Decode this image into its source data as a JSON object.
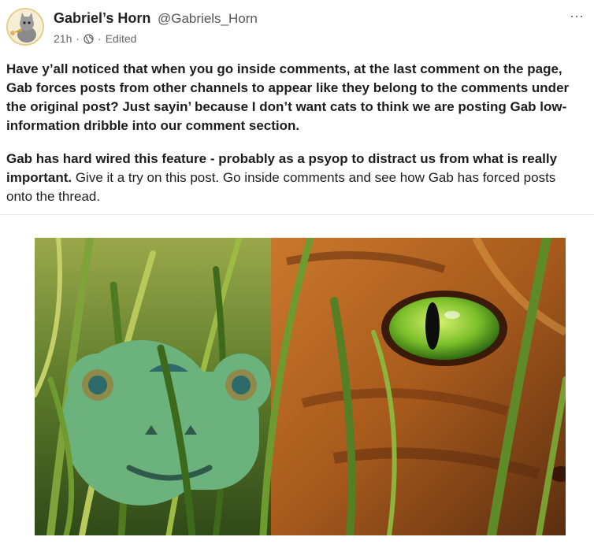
{
  "author": {
    "name": "Gabriel’s Horn",
    "handle": "@Gabriels_Horn",
    "avatar_icon": "cat-with-horn-avatar"
  },
  "meta": {
    "time": "21h",
    "separator": "·",
    "visibility_icon": "globe-icon",
    "edited": "Edited"
  },
  "menu": {
    "more_label": "···"
  },
  "post": {
    "paragraph1": "Have y’all noticed that when you go inside comments, at the last comment on the page, Gab forces posts from other channels to appear like they belong to the comments under the original post? Just sayin’ because I don’t want cats to think we are posting Gab low-information dribble into our comment section.",
    "paragraph2_bold": "Gab has hard wired this feature - probably as a psyop to distract us from what is really important.",
    "paragraph2_rest": " Give it a try on this post. Go inside comments and see how Gab has forced posts onto the thread."
  },
  "media": {
    "image_subject": "gab-frog-logo-and-cat-eye-in-grass"
  }
}
